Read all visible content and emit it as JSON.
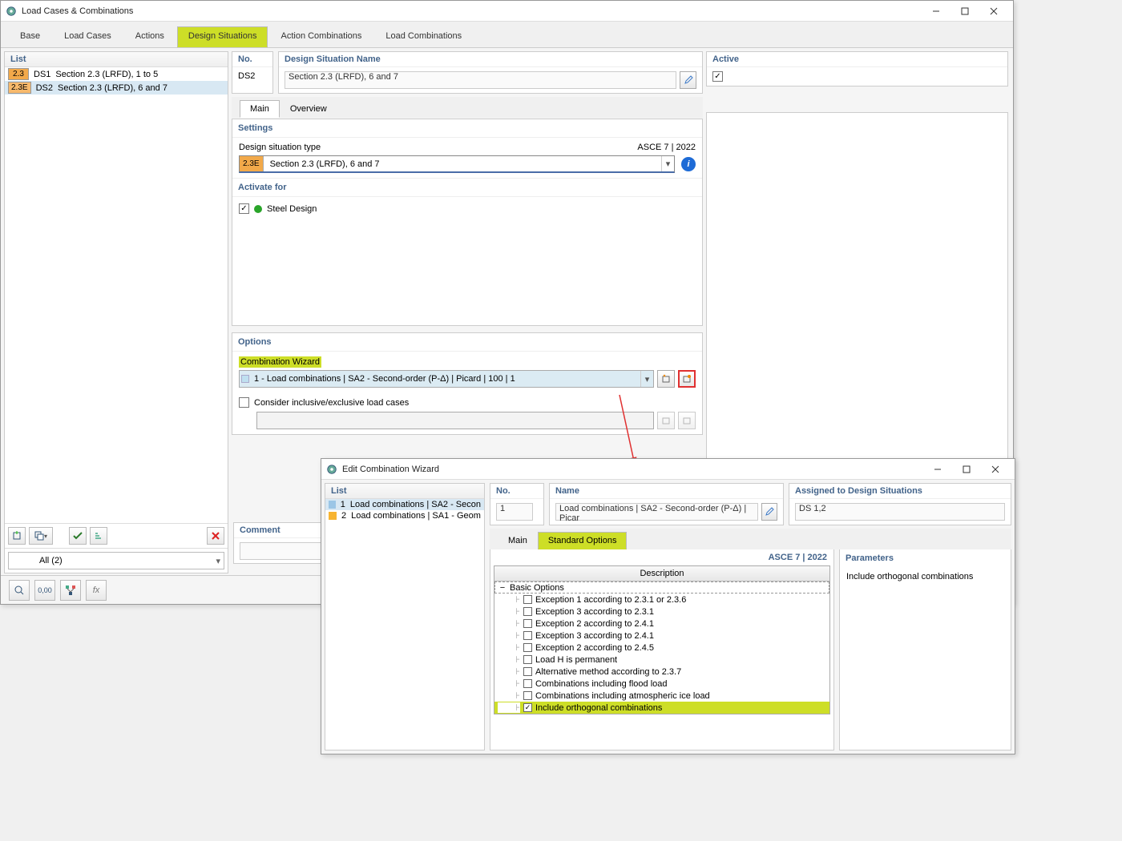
{
  "window1": {
    "title": "Load Cases & Combinations",
    "tabs": [
      "Base",
      "Load Cases",
      "Actions",
      "Design Situations",
      "Action Combinations",
      "Load Combinations"
    ],
    "activeTab": "Design Situations",
    "listHeader": "List",
    "listItems": [
      {
        "badge": "2.3",
        "code": "DS1",
        "text": "Section 2.3 (LRFD), 1 to 5",
        "badgeClass": "orange"
      },
      {
        "badge": "2.3E",
        "code": "DS2",
        "text": "Section 2.3 (LRFD), 6 and 7",
        "badgeClass": "orange2"
      }
    ],
    "listFilter": "All (2)",
    "noHeader": "No.",
    "noValue": "DS2",
    "dsNameHeader": "Design Situation Name",
    "dsNameValue": "Section 2.3 (LRFD), 6 and 7",
    "activeHeader": "Active",
    "subTabs": [
      "Main",
      "Overview"
    ],
    "activeSubTab": "Main",
    "settingsHeader": "Settings",
    "dsTypeLabel": "Design situation type",
    "codeLabel": "ASCE 7 | 2022",
    "dsTypeBadge": "2.3E",
    "dsTypeValue": "Section 2.3 (LRFD), 6 and 7",
    "activateHeader": "Activate for",
    "activateItem": "Steel Design",
    "optionsHeader": "Options",
    "combWizardLabel": "Combination Wizard",
    "combWizardValue": "1 - Load combinations | SA2 - Second-order (P-Δ) | Picard | 100 | 1",
    "considerLabel": "Consider inclusive/exclusive load cases",
    "commentHeader": "Comment",
    "commentValue": ""
  },
  "window2": {
    "title": "Edit Combination Wizard",
    "listHeader": "List",
    "listItems": [
      {
        "num": "1",
        "text": "Load combinations | SA2 - Secon",
        "color": "#9bc6e6"
      },
      {
        "num": "2",
        "text": "Load combinations | SA1 - Geom",
        "color": "#f7b431"
      }
    ],
    "noHeader": "No.",
    "noValue": "1",
    "nameHeader": "Name",
    "nameValue": "Load combinations | SA2 - Second-order (P-Δ) | Picar",
    "assignedHeader": "Assigned to Design Situations",
    "assignedValue": "DS 1,2",
    "subTabs": [
      "Main",
      "Standard Options"
    ],
    "activeSubTab": "Standard Options",
    "codeLabel": "ASCE 7 | 2022",
    "descHeader": "Description",
    "paramHeader": "Parameters",
    "paramValue": "Include orthogonal combinations",
    "treeRoot": "Basic Options",
    "treeItems": [
      "Exception 1 according to 2.3.1 or 2.3.6",
      "Exception 3 according to 2.3.1",
      "Exception 2 according to 2.4.1",
      "Exception 3 according to 2.4.1",
      "Exception 2 according to 2.4.5",
      "Load H is permanent",
      "Alternative method according to 2.3.7",
      "Combinations including flood load",
      "Combinations including atmospheric ice load",
      "Include orthogonal combinations"
    ]
  }
}
